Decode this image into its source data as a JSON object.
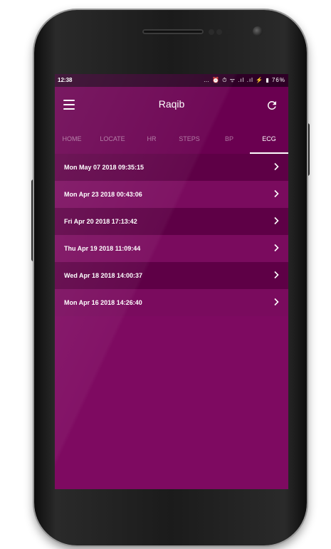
{
  "statusbar": {
    "time": "12:38",
    "icons_text": "… ⏰ ⏱ ᯤ .ıl .ıl ⚡ ▮ 76%",
    "battery": "76%"
  },
  "appbar": {
    "title": "Raqib",
    "menu_icon": "menu-icon",
    "refresh_icon": "refresh-icon"
  },
  "tabs": [
    {
      "label": "HOME",
      "active": false
    },
    {
      "label": "LOCATE",
      "active": false
    },
    {
      "label": "HR",
      "active": false
    },
    {
      "label": "STEPS",
      "active": false
    },
    {
      "label": "BP",
      "active": false
    },
    {
      "label": "ECG",
      "active": true
    }
  ],
  "records": [
    {
      "label": "Mon May 07 2018 09:35:15"
    },
    {
      "label": "Mon Apr 23 2018 00:43:06"
    },
    {
      "label": "Fri Apr 20 2018 17:13:42"
    },
    {
      "label": "Thu Apr 19 2018 11:09:44"
    },
    {
      "label": "Wed Apr 18 2018 14:00:37"
    },
    {
      "label": "Mon Apr 16 2018 14:26:40"
    }
  ],
  "colors": {
    "screen_bg": "#7e0a61",
    "appbar_bg": "#6a0050",
    "row_dark": "#5e0046",
    "row_light": "#7a0b5e",
    "statusbar_bg": "#2e0026"
  }
}
